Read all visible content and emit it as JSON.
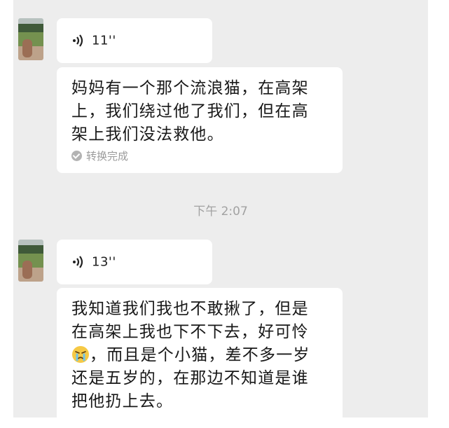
{
  "conversation": {
    "timestamp": "下午 2:07",
    "messages": [
      {
        "voice_duration": "11''",
        "text": "妈妈有一个那个流浪猫，在高架\n上，我们绕过他了我们，但在高\n架上我们没法救他。",
        "status": "转换完成"
      },
      {
        "voice_duration": "13''",
        "text_part1": "我知道我们我也不敢揪了，但是\n在高架上我也下不下去，好可怜\n",
        "emoji": "crying-face-icon",
        "text_part2": "，而且是个小猫，差不多一岁\n还是五岁的，在那边不知道是谁\n把他扔上去。"
      }
    ]
  }
}
